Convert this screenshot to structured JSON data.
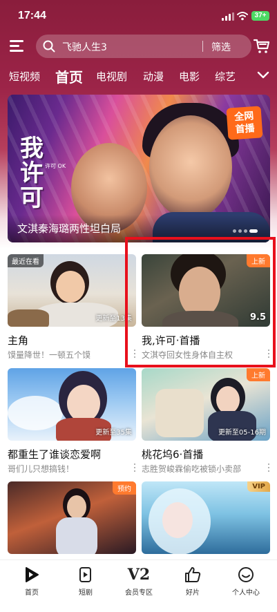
{
  "status_bar": {
    "time": "17:44",
    "battery": "37+"
  },
  "search": {
    "query": "飞驰人生3",
    "filter_label": "筛选"
  },
  "tabs": [
    {
      "label": "短视频"
    },
    {
      "label": "首页",
      "active": true
    },
    {
      "label": "电视剧"
    },
    {
      "label": "动漫"
    },
    {
      "label": "电影"
    },
    {
      "label": "综艺"
    }
  ],
  "hero": {
    "logo_text": "我许可",
    "logo_sub": "许可 OK",
    "badge": "全网首播",
    "title": "文淇秦海璐两性坦白局",
    "dots": 4
  },
  "cards": [
    {
      "title": "主角",
      "subtitle": "馍量降世！一顿五个馍",
      "tag_left": "最近在看",
      "overlay": "更新至13集"
    },
    {
      "title": "我,许可·首播",
      "subtitle": "文淇夺回女性身体自主权",
      "tag_right": "上新",
      "score": "9.5"
    },
    {
      "title": "都重生了谁谈恋爱啊",
      "subtitle": "哥们儿只想搞钱！",
      "overlay": "更新至35集"
    },
    {
      "title": "桃花坞6·首播",
      "subtitle": "志胜贺峻霖偷吃被锁小卖部",
      "tag_right": "上新",
      "overlay": "更新至05-16期"
    },
    {
      "tag_right": "预约"
    },
    {
      "tag_right": "VIP"
    }
  ],
  "bottom_nav": [
    {
      "label": "首页",
      "icon": "home-play-icon"
    },
    {
      "label": "短剧",
      "icon": "short-drama-icon"
    },
    {
      "label": "会员专区",
      "icon_text": "V2"
    },
    {
      "label": "好片",
      "icon": "thumbs-up-icon"
    },
    {
      "label": "个人中心",
      "icon": "profile-smile-icon"
    }
  ],
  "colors": {
    "accent_red": "#e8101c",
    "tag_orange": "#ff7a2e",
    "header_bg": "#9c2448"
  }
}
